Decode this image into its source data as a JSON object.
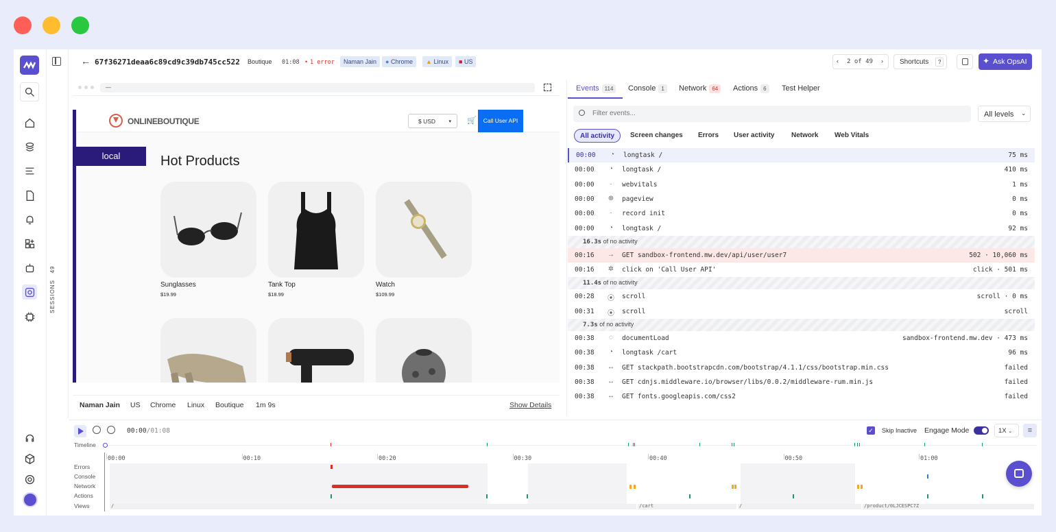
{
  "window": {
    "close_color": "#ff5f57",
    "min_color": "#febc2e",
    "max_color": "#28c840"
  },
  "header": {
    "session_id": "67f36271deaa6c89cd9c39db745cc522",
    "app": "Boutique",
    "duration": "01:08",
    "errors": "1 error",
    "chips": [
      "Naman Jain",
      "Chrome",
      "Linux",
      "US"
    ],
    "pager": "2 of 49",
    "shortcuts_label": "Shortcuts",
    "shortcuts_key": "?",
    "ask_label": "Ask OpsAI"
  },
  "rail": {
    "sessions_label": "SESSIONS",
    "sessions_count": "49"
  },
  "browser": {
    "url": "—"
  },
  "site": {
    "logo": "ONLINEBOUTIQUE",
    "currency": "$  USD",
    "call_api": "Call User API",
    "env_label": "local",
    "heading": "Hot Products",
    "products": [
      {
        "name": "Sunglasses",
        "price": "$19.99"
      },
      {
        "name": "Tank Top",
        "price": "$18.99"
      },
      {
        "name": "Watch",
        "price": "$109.99"
      }
    ]
  },
  "details": {
    "user": "Naman Jain",
    "country": "US",
    "browser": "Chrome",
    "os": "Linux",
    "app": "Boutique",
    "duration": "1m 9s",
    "show_details": "Show Details"
  },
  "panel": {
    "tabs": [
      {
        "label": "Events",
        "count": "114"
      },
      {
        "label": "Console",
        "count": "1"
      },
      {
        "label": "Network",
        "count": "64"
      },
      {
        "label": "Actions",
        "count": "6"
      },
      {
        "label": "Test Helper",
        "count": ""
      }
    ],
    "filter_placeholder": "Filter events...",
    "levels": "All levels",
    "pills": [
      "All activity",
      "Screen changes",
      "Errors",
      "User activity",
      "Network",
      "Web Vitals"
    ],
    "events": [
      {
        "time": "00:00",
        "icon": "gauge",
        "label": "longtask /",
        "right": "75 ms"
      },
      {
        "time": "00:00",
        "icon": "gauge",
        "label": "longtask /",
        "right": "410 ms"
      },
      {
        "time": "00:00",
        "icon": "dot",
        "label": "webvitals",
        "right": "1 ms"
      },
      {
        "time": "00:00",
        "icon": "globe",
        "label": "pageview",
        "right": "0 ms"
      },
      {
        "time": "00:00",
        "icon": "dot",
        "label": "record init",
        "right": "0 ms"
      },
      {
        "time": "00:00",
        "icon": "gauge",
        "label": "longtask /",
        "right": "92 ms"
      },
      {
        "gap": "16.3s",
        "note": "of no activity"
      },
      {
        "time": "00:16",
        "icon": "arrow",
        "label": "GET sandbox-frontend.mw.dev/api/user/user7",
        "right": "502 · 10,060 ms"
      },
      {
        "time": "00:16",
        "icon": "click",
        "label": "click on 'Call User API'",
        "right": "click · 501 ms"
      },
      {
        "gap": "11.4s",
        "note": "of no activity"
      },
      {
        "time": "00:28",
        "icon": "mouse",
        "label": "scroll",
        "right": "scroll · 0 ms"
      },
      {
        "time": "00:31",
        "icon": "mouse",
        "label": "scroll",
        "right": "scroll"
      },
      {
        "gap": "7.3s",
        "note": "of no activity"
      },
      {
        "time": "00:38",
        "icon": "load",
        "label": "documentLoad",
        "right": "sandbox-frontend.mw.dev · 473 ms"
      },
      {
        "time": "00:38",
        "icon": "gauge",
        "label": "longtask /cart",
        "right": "96 ms"
      },
      {
        "time": "00:38",
        "icon": "swap",
        "label": "GET stackpath.bootstrapcdn.com/bootstrap/4.1.1/css/bootstrap.min.css",
        "right": "failed"
      },
      {
        "time": "00:38",
        "icon": "swap",
        "label": "GET cdnjs.middleware.io/browser/libs/0.0.2/middleware-rum.min.js",
        "right": "failed"
      },
      {
        "time": "00:38",
        "icon": "swap",
        "label": "GET fonts.googleapis.com/css2",
        "right": "failed"
      }
    ]
  },
  "player": {
    "time": "00:00",
    "total": "/01:08",
    "skip_inactive": "Skip Inactive",
    "engage": "Engage Mode",
    "speed": "1X",
    "timeline_label": "Timeline",
    "ticks": [
      "00:00",
      "00:10",
      "00:20",
      "00:30",
      "00:40",
      "00:50",
      "01:00"
    ],
    "rows": [
      "Errors",
      "Console",
      "Network",
      "Actions",
      "Views"
    ],
    "views": [
      "/",
      "/cart",
      "/",
      "/product/0LJCESPC7Z"
    ]
  },
  "colors": {
    "accent": "#5a4fcf",
    "error": "#d93025",
    "network": "#f5a623",
    "action": "#1a9a6c",
    "sidebar_env": "#2a1a7a",
    "callapi": "#0a6ef5"
  }
}
